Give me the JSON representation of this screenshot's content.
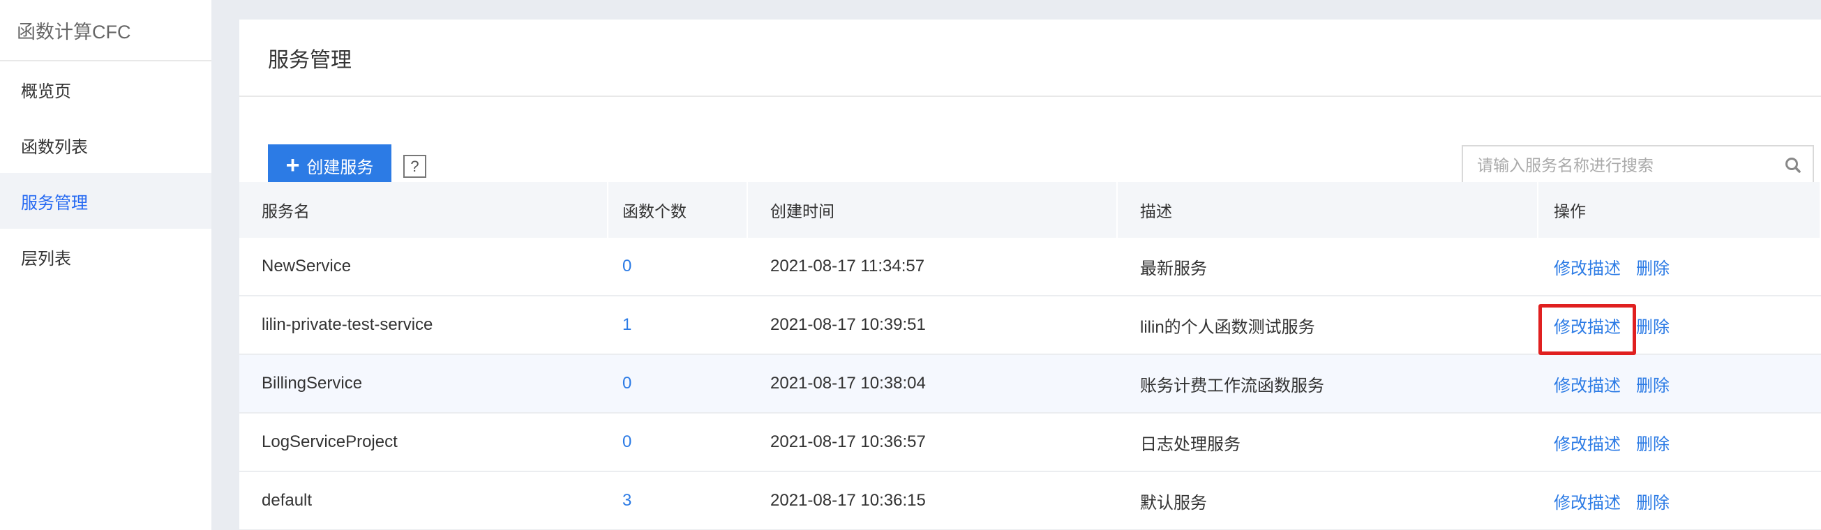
{
  "sidebar": {
    "title": "函数计算CFC",
    "items": [
      {
        "label": "概览页",
        "active": false
      },
      {
        "label": "函数列表",
        "active": false
      },
      {
        "label": "服务管理",
        "active": true
      },
      {
        "label": "层列表",
        "active": false
      }
    ]
  },
  "page": {
    "title": "服务管理",
    "create_button_label": "创建服务",
    "help_label": "?",
    "search_placeholder": "请输入服务名称进行搜索"
  },
  "table": {
    "columns": [
      "服务名",
      "函数个数",
      "创建时间",
      "描述",
      "操作"
    ],
    "rows": [
      {
        "name": "NewService",
        "count": "0",
        "created": "2021-08-17 11:34:57",
        "desc": "最新服务"
      },
      {
        "name": "lilin-private-test-service",
        "count": "1",
        "created": "2021-08-17 10:39:51",
        "desc": "lilin的个人函数测试服务"
      },
      {
        "name": "BillingService",
        "count": "0",
        "created": "2021-08-17 10:38:04",
        "desc": "账务计费工作流函数服务"
      },
      {
        "name": "LogServiceProject",
        "count": "0",
        "created": "2021-08-17 10:36:57",
        "desc": "日志处理服务"
      },
      {
        "name": "default",
        "count": "3",
        "created": "2021-08-17 10:36:15",
        "desc": "默认服务"
      }
    ],
    "actions": {
      "edit": "修改描述",
      "delete": "删除"
    }
  },
  "colors": {
    "accent": "#2c7be5",
    "active_nav": "#2468f2",
    "highlight": "#e02020"
  }
}
